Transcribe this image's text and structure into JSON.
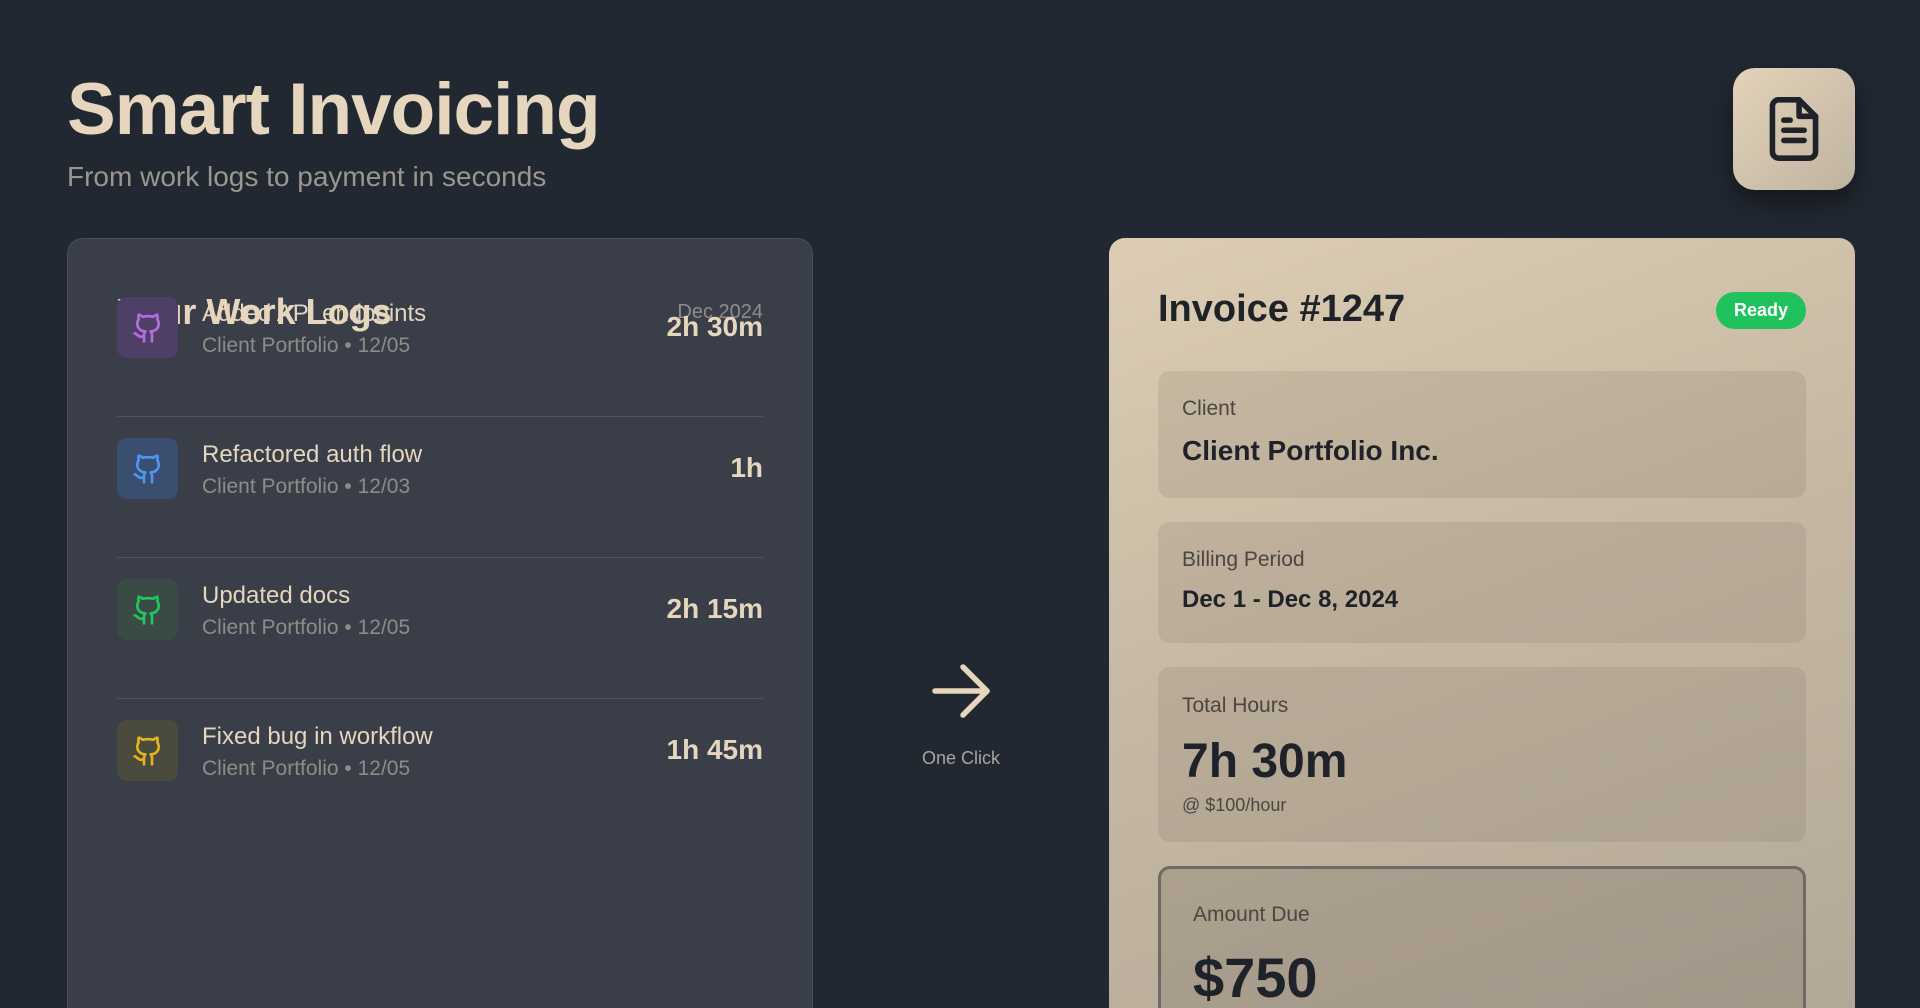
{
  "header": {
    "title": "Smart Invoicing",
    "subtitle": "From work logs to payment in seconds",
    "icon": "document-icon"
  },
  "work_logs": {
    "title": "Your Work Logs",
    "month": "Dec 2024",
    "items": [
      {
        "title": "Added API endpoints",
        "meta": "Client Portfolio • 12/05",
        "duration": "2h 30m",
        "icon": "github-icon",
        "icon_color": "#b56ee0",
        "icon_bg": "#4d3f66"
      },
      {
        "title": "Refactored auth flow",
        "meta": "Client Portfolio • 12/03",
        "duration": "1h",
        "icon": "github-icon",
        "icon_color": "#4d95f2",
        "icon_bg": "#3a4e70"
      },
      {
        "title": "Updated docs",
        "meta": "Client Portfolio • 12/05",
        "duration": "2h 15m",
        "icon": "github-icon",
        "icon_color": "#22c55e",
        "icon_bg": "#3a4a45"
      },
      {
        "title": "Fixed bug in workflow",
        "meta": "Client Portfolio • 12/05",
        "duration": "1h 45m",
        "icon": "github-icon",
        "icon_color": "#e4b41c",
        "icon_bg": "#4a4a3e"
      }
    ]
  },
  "flow": {
    "label": "One Click",
    "icon": "arrow-right-icon"
  },
  "invoice": {
    "title": "Invoice #1247",
    "status": "Ready",
    "status_color": "#1fc25c",
    "client_label": "Client",
    "client_value": "Client Portfolio Inc.",
    "period_label": "Billing Period",
    "period_value": "Dec 1 - Dec 8, 2024",
    "hours_label": "Total Hours",
    "hours_value": "7h 30m",
    "rate": "@ $100/hour",
    "amount_label": "Amount Due",
    "amount_value": "$750"
  }
}
